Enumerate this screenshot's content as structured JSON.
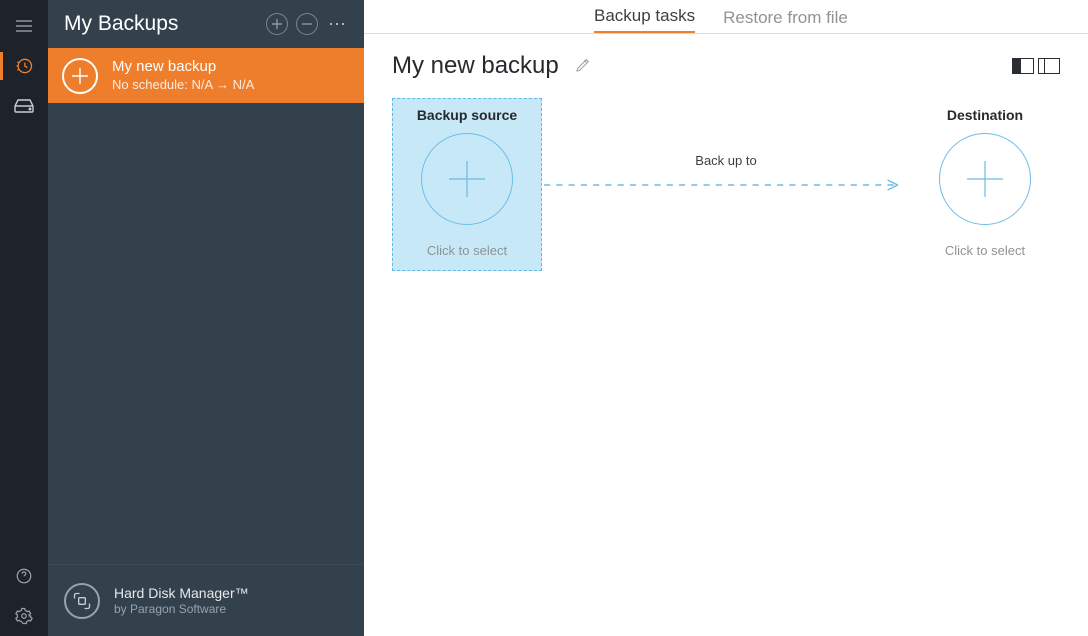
{
  "sidebar": {
    "title": "My Backups",
    "item": {
      "title": "My new backup",
      "subtitle": "No schedule: N/A → N/A"
    },
    "footer": {
      "title": "Hard Disk Manager™",
      "subtitle": "by Paragon Software"
    }
  },
  "tabs": {
    "backup": "Backup tasks",
    "restore": "Restore from file"
  },
  "main": {
    "title": "My new backup",
    "source": {
      "title": "Backup source",
      "hint": "Click to select"
    },
    "dest": {
      "title": "Destination",
      "hint": "Click to select"
    },
    "arrow_label": "Back up to"
  }
}
